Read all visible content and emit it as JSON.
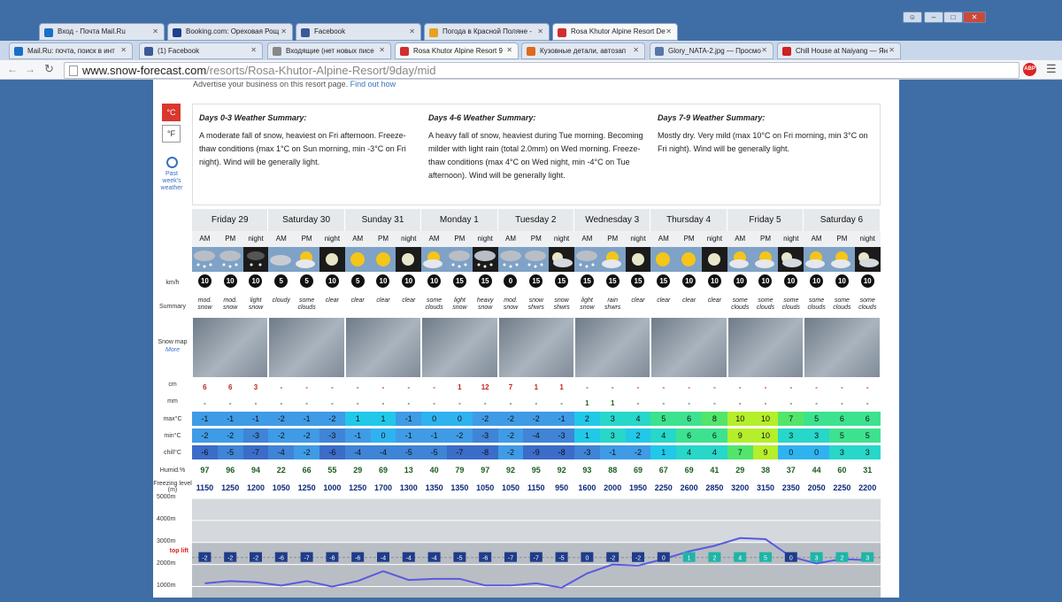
{
  "browser": {
    "tabs_row1": [
      {
        "label": "Вход - Почта Mail.Ru",
        "color": "#1b6fc7"
      },
      {
        "label": "Booking.com: Ореховая Рощ",
        "color": "#1f3f8c"
      },
      {
        "label": "Facebook",
        "color": "#3b5998"
      },
      {
        "label": "Погода в Красной Поляне -",
        "color": "#e8a21e"
      },
      {
        "label": "Rosa Khutor Alpine Resort De",
        "color": "#d12e2e"
      }
    ],
    "tabs_row2": [
      {
        "label": "Mail.Ru: почта, поиск в инт",
        "color": "#1b6fc7"
      },
      {
        "label": "(1) Facebook",
        "color": "#3b5998"
      },
      {
        "label": "Входящие (нет новых писе",
        "color": "#888888"
      },
      {
        "label": "Rosa Khutor Alpine Resort 9",
        "color": "#d12e2e"
      },
      {
        "label": "Кузовные детали, автозап",
        "color": "#e06a1a"
      },
      {
        "label": "Glory_NATA-2.jpg — Просмо",
        "color": "#5577aa"
      },
      {
        "label": "Chill House at Naiyang — Ян",
        "color": "#cc2222"
      }
    ],
    "url_host": "www.snow-forecast.com",
    "url_path": "/resorts/Rosa-Khutor-Alpine-Resort/9day/mid"
  },
  "page": {
    "ad_text": "Advertise your business on this resort page.",
    "ad_link": "Find out how",
    "unit_c": "°C",
    "unit_f": "°F",
    "past_weather": "Past week's weather",
    "summaries": [
      {
        "title": "Days 0-3 Weather Summary:",
        "text": "A moderate fall of snow, heaviest on Fri afternoon. Freeze-thaw conditions (max 1°C on Sun morning, min -3°C on Fri night). Wind will be generally light."
      },
      {
        "title": "Days 4-6 Weather Summary:",
        "text": "A heavy fall of snow, heaviest during Tue morning. Becoming milder with light rain (total 2.0mm) on Wed morning. Freeze-thaw conditions (max 4°C on Wed night, min -4°C on Tue afternoon). Wind will be generally light."
      },
      {
        "title": "Days 7-9 Weather Summary:",
        "text": "Mostly dry. Very mild (max 10°C on Fri morning, min 3°C on Fri night). Wind will be generally light."
      }
    ]
  },
  "forecast": {
    "days": [
      "Friday 29",
      "Saturday 30",
      "Sunday 31",
      "Monday 1",
      "Tuesday 2",
      "Wednesday 3",
      "Thursday 4",
      "Friday 5",
      "Saturday 6"
    ],
    "periods": [
      "AM",
      "PM",
      "night"
    ],
    "labels": {
      "wind": "km/h",
      "summary": "Summary",
      "snowmap": "Snow map",
      "more": "More",
      "snow": "cm",
      "rain": "mm",
      "max": "max°C",
      "min": "min°C",
      "chill": "chill°C",
      "humid": "Humid.%",
      "freezing": "Freezing level (m)"
    },
    "wind": [
      "10",
      "10",
      "10",
      "5",
      "5",
      "10",
      "5",
      "10",
      "10",
      "10",
      "15",
      "15",
      "0",
      "15",
      "15",
      "15",
      "15",
      "15",
      "15",
      "10",
      "10",
      "10",
      "10",
      "10",
      "10",
      "10",
      "10"
    ],
    "summary": [
      "mod. snow",
      "mod. snow",
      "light snow",
      "cloudy",
      "some clouds",
      "clear",
      "clear",
      "clear",
      "clear",
      "some clouds",
      "light snow",
      "heavy snow",
      "mod. snow",
      "snow shwrs",
      "snow shwrs",
      "light snow",
      "rain shwrs",
      "clear",
      "clear",
      "clear",
      "clear",
      "some clouds",
      "some clouds",
      "some clouds",
      "some clouds",
      "some clouds",
      "some clouds"
    ],
    "icons": [
      "snow",
      "snow",
      "snow-night",
      "cloud",
      "sun-cloud",
      "moon",
      "sun",
      "sun",
      "moon",
      "sun-cloud",
      "snow",
      "snow",
      "snow",
      "snow",
      "moon-cloud",
      "snow",
      "sun-cloud",
      "moon",
      "sun",
      "sun",
      "moon",
      "sun-cloud",
      "sun-cloud",
      "moon-cloud",
      "sun-cloud",
      "sun-cloud",
      "moon-cloud"
    ],
    "snow": [
      "6",
      "6",
      "3",
      "-",
      "-",
      "-",
      "-",
      "-",
      "-",
      "-",
      "1",
      "12",
      "7",
      "1",
      "1",
      "-",
      "-",
      "-",
      "-",
      "-",
      "-",
      "-",
      "-",
      "-",
      "-",
      "-",
      "-"
    ],
    "rain": [
      "-",
      "-",
      "-",
      "-",
      "-",
      "-",
      "-",
      "-",
      "-",
      "-",
      "-",
      "-",
      "-",
      "-",
      "-",
      "1",
      "1",
      "-",
      "-",
      "-",
      "-",
      "-",
      "-",
      "-",
      "-",
      "-",
      "-"
    ],
    "max": [
      -1,
      -1,
      -1,
      -2,
      -1,
      -2,
      1,
      1,
      -1,
      0,
      0,
      -2,
      -2,
      -2,
      -1,
      2,
      3,
      4,
      5,
      6,
      8,
      10,
      10,
      7,
      5,
      6,
      6
    ],
    "min": [
      -2,
      -2,
      -3,
      -2,
      -2,
      -3,
      -1,
      0,
      -1,
      -1,
      -2,
      -3,
      -2,
      -4,
      -3,
      1,
      3,
      2,
      4,
      6,
      6,
      9,
      10,
      3,
      3,
      5,
      5
    ],
    "chill": [
      -6,
      -5,
      -7,
      -4,
      -2,
      -6,
      -4,
      -4,
      -5,
      -5,
      -7,
      -8,
      -2,
      -9,
      -8,
      -3,
      -1,
      -2,
      1,
      4,
      4,
      7,
      9,
      0,
      0,
      3,
      3
    ],
    "humid": [
      "97",
      "96",
      "94",
      "22",
      "66",
      "55",
      "29",
      "69",
      "13",
      "40",
      "79",
      "97",
      "92",
      "95",
      "92",
      "93",
      "88",
      "69",
      "67",
      "69",
      "41",
      "29",
      "38",
      "37",
      "44",
      "60",
      "31"
    ],
    "freezing": [
      "1150",
      "1250",
      "1200",
      "1050",
      "1250",
      "1000",
      "1250",
      "1700",
      "1300",
      "1350",
      "1350",
      "1050",
      "1050",
      "1150",
      "950",
      "1600",
      "2000",
      "1950",
      "2250",
      "2600",
      "2850",
      "3200",
      "3150",
      "2350",
      "2050",
      "2250",
      "2200"
    ]
  },
  "chart_data": {
    "type": "line",
    "ylabels": [
      "5000m",
      "4000m",
      "3000m",
      "2000m",
      "1000m"
    ],
    "top_lift": "top lift",
    "series": [
      {
        "values": [
          1150,
          1250,
          1200,
          1050,
          1250,
          1000,
          1250,
          1700,
          1300,
          1350,
          1350,
          1050,
          1050,
          1150,
          950,
          1600,
          2000,
          1950,
          2250,
          2600,
          2850,
          3200,
          3150,
          2350,
          2050,
          2250,
          2200
        ]
      }
    ],
    "temps": [
      "-2",
      "-2",
      "-2",
      "-6",
      "-7",
      "-6",
      "-6",
      "-4",
      "-4",
      "-4",
      "-5",
      "-6",
      "-7",
      "-7",
      "-5",
      "0",
      "-2",
      "-2",
      "0",
      "1",
      "2",
      "4",
      "5",
      "0",
      "3",
      "2",
      "3"
    ]
  }
}
